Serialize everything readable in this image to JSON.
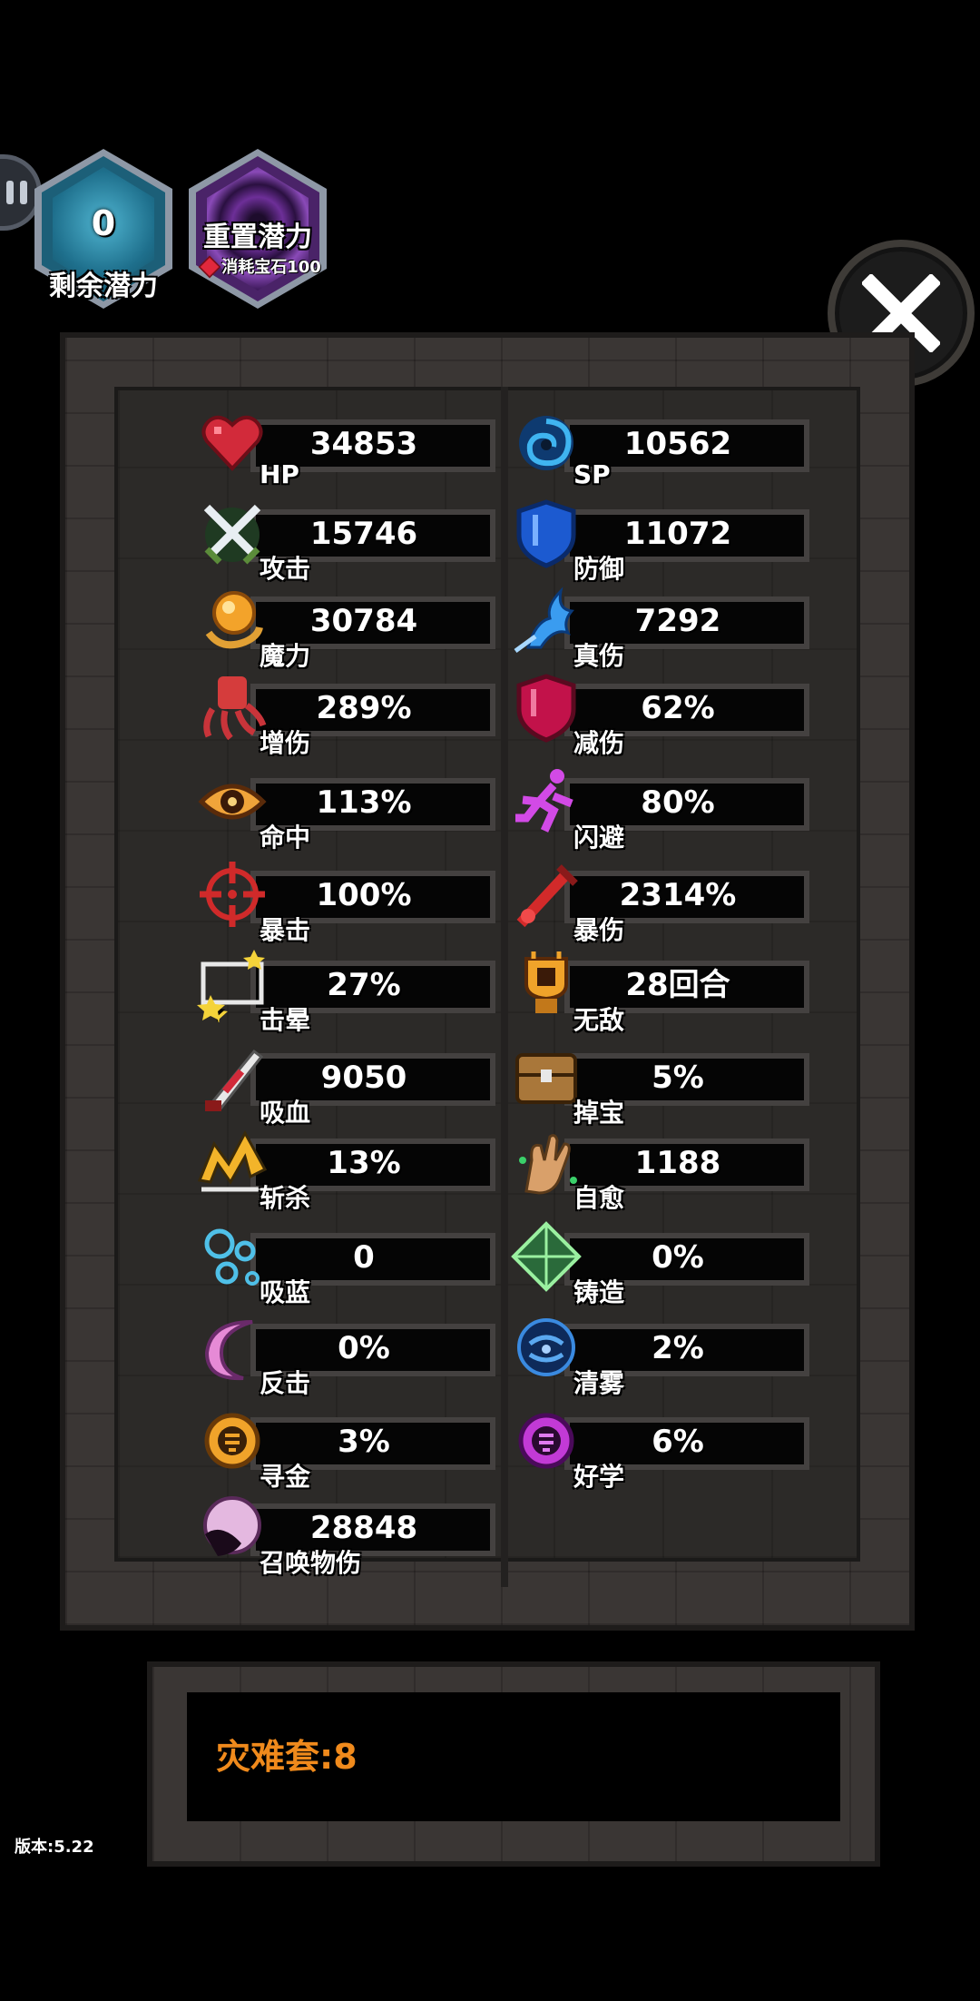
{
  "header": {
    "remaining_potential_value": "0",
    "remaining_potential_label": "剩余潜力",
    "reset_potential_label": "重置潜力",
    "reset_cost_label": "消耗宝石100"
  },
  "stats_left": [
    {
      "icon": "heart-icon",
      "label": "HP",
      "value": "34853"
    },
    {
      "icon": "crossed-swords-icon",
      "label": "攻击",
      "value": "15746"
    },
    {
      "icon": "magic-orb-icon",
      "label": "魔力",
      "value": "30784"
    },
    {
      "icon": "fist-icon",
      "label": "增伤",
      "value": "289%"
    },
    {
      "icon": "eye-icon",
      "label": "命中",
      "value": "113%"
    },
    {
      "icon": "crosshair-icon",
      "label": "暴击",
      "value": "100%"
    },
    {
      "icon": "stars-icon",
      "label": "击晕",
      "value": "27%"
    },
    {
      "icon": "blood-knife-icon",
      "label": "吸血",
      "value": "9050"
    },
    {
      "icon": "slash-icon",
      "label": "斩杀",
      "value": "13%"
    },
    {
      "icon": "bubbles-icon",
      "label": "吸蓝",
      "value": "0"
    },
    {
      "icon": "crescent-icon",
      "label": "反击",
      "value": "0%"
    },
    {
      "icon": "gold-coin-icon",
      "label": "寻金",
      "value": "3%"
    },
    {
      "icon": "summon-orb-icon",
      "label": "召唤物伤",
      "value": "28848"
    }
  ],
  "stats_right": [
    {
      "icon": "vortex-icon",
      "label": "SP",
      "value": "10562"
    },
    {
      "icon": "shield-icon",
      "label": "防御",
      "value": "11072"
    },
    {
      "icon": "blue-flame-icon",
      "label": "真伤",
      "value": "7292"
    },
    {
      "icon": "red-shield-icon",
      "label": "减伤",
      "value": "62%"
    },
    {
      "icon": "running-figure-icon",
      "label": "闪避",
      "value": "80%"
    },
    {
      "icon": "bloody-sword-icon",
      "label": "暴伤",
      "value": "2314%"
    },
    {
      "icon": "trophy-icon",
      "label": "无敌",
      "value": "28回合"
    },
    {
      "icon": "treasure-chest-icon",
      "label": "掉宝",
      "value": "5%"
    },
    {
      "icon": "healing-hand-icon",
      "label": "自愈",
      "value": "1188"
    },
    {
      "icon": "forge-diamond-icon",
      "label": "铸造",
      "value": "0%"
    },
    {
      "icon": "fog-icon",
      "label": "清雾",
      "value": "2%"
    },
    {
      "icon": "purple-coin-icon",
      "label": "好学",
      "value": "6%"
    }
  ],
  "set_bonus": "灾难套:8",
  "version": "版本:5.22"
}
